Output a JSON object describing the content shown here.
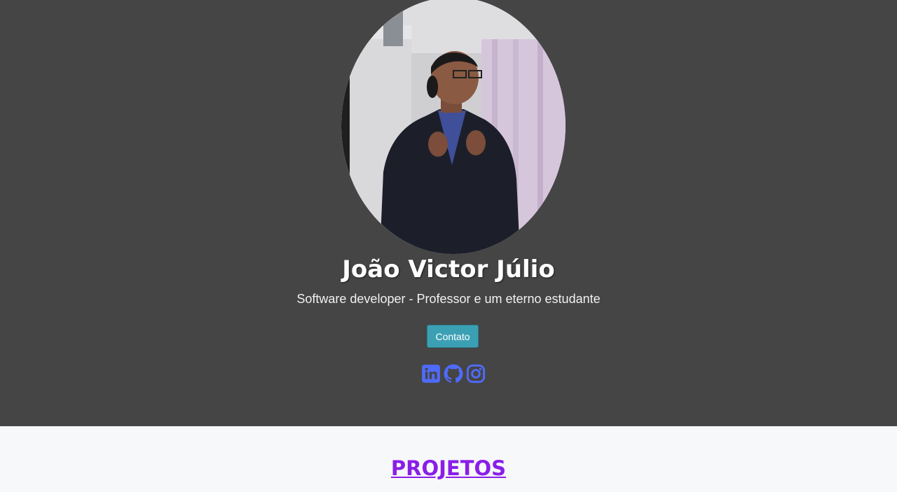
{
  "profile": {
    "name": "João Victor Júlio",
    "subtitle": "Software developer - Professor e um eterno estudante",
    "photo_alt": "profile-photo"
  },
  "buttons": {
    "contact_label": "Contato"
  },
  "socials": [
    {
      "icon": "linkedin-icon"
    },
    {
      "icon": "github-icon"
    },
    {
      "icon": "instagram-icon"
    }
  ],
  "sections": {
    "projects_title": "PROJETOS"
  },
  "colors": {
    "hero_bg": "#454545",
    "page_bg": "#f7f8fa",
    "button_bg": "#3ca0b4",
    "social_icon": "#4f6bff",
    "projects_link": "#8a1ee8"
  }
}
